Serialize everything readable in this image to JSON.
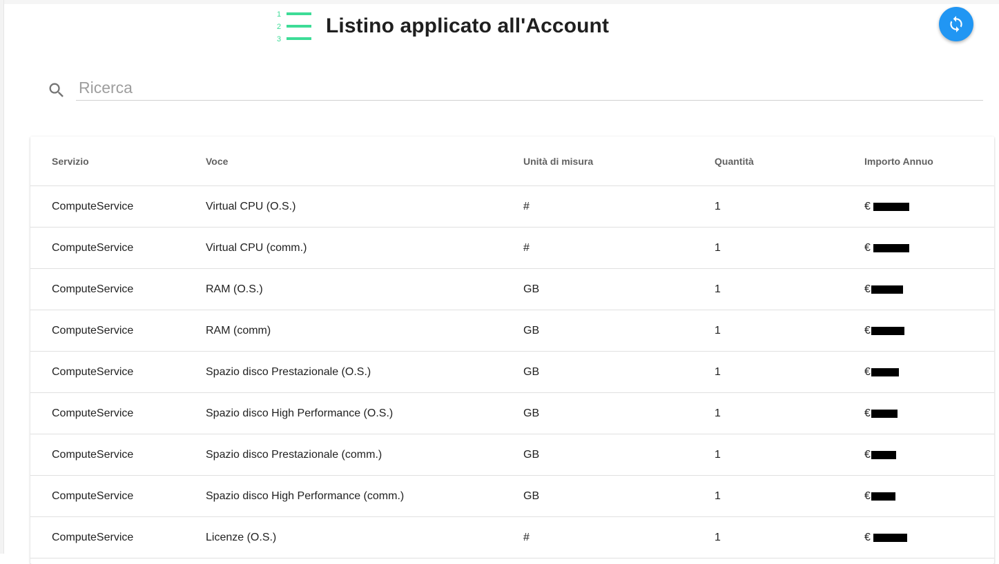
{
  "header": {
    "title": "Listino applicato all'Account",
    "icon": "numbered-list-icon",
    "icon_numbers": [
      "1",
      "2",
      "3"
    ],
    "accent_color": "#3ddc97"
  },
  "actions": {
    "refresh_icon": "refresh-icon",
    "refresh_color": "#2196f3"
  },
  "search": {
    "placeholder": "Ricerca",
    "value": ""
  },
  "table": {
    "columns": [
      "Servizio",
      "Voce",
      "Unità di misura",
      "Quantità",
      "Importo Annuo"
    ],
    "currency": "€",
    "rows": [
      {
        "servizio": "ComputeService",
        "voce": "Virtual CPU (O.S.)",
        "unita": "#",
        "quantita": "1",
        "euro": "€"
      },
      {
        "servizio": "ComputeService",
        "voce": "Virtual CPU (comm.)",
        "unita": "#",
        "quantita": "1",
        "euro": "€"
      },
      {
        "servizio": "ComputeService",
        "voce": "RAM (O.S.)",
        "unita": "GB",
        "quantita": "1",
        "euro": "€"
      },
      {
        "servizio": "ComputeService",
        "voce": "RAM (comm)",
        "unita": "GB",
        "quantita": "1",
        "euro": "€"
      },
      {
        "servizio": "ComputeService",
        "voce": "Spazio disco Prestazionale (O.S.)",
        "unita": "GB",
        "quantita": "1",
        "euro": "€"
      },
      {
        "servizio": "ComputeService",
        "voce": "Spazio disco High Performance (O.S.)",
        "unita": "GB",
        "quantita": "1",
        "euro": "€"
      },
      {
        "servizio": "ComputeService",
        "voce": "Spazio disco Prestazionale (comm.)",
        "unita": "GB",
        "quantita": "1",
        "euro": "€"
      },
      {
        "servizio": "ComputeService",
        "voce": "Spazio disco High Performance (comm.)",
        "unita": "GB",
        "quantita": "1",
        "euro": "€"
      },
      {
        "servizio": "ComputeService",
        "voce": "Licenze (O.S.)",
        "unita": "#",
        "quantita": "1",
        "euro": "€"
      }
    ]
  }
}
